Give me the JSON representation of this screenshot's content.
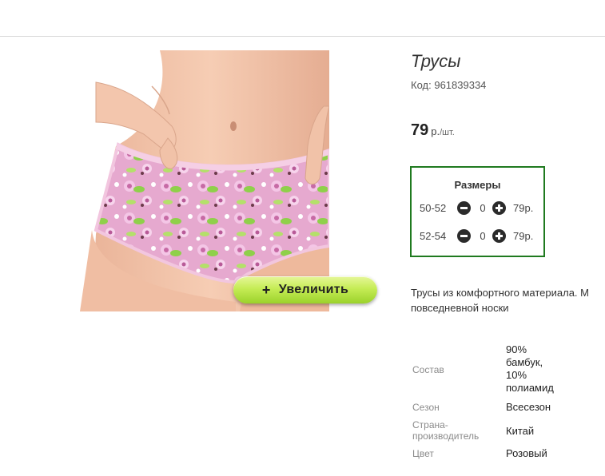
{
  "product": {
    "title": "Трусы",
    "code_label": "Код:",
    "code": "961839334",
    "price": "79",
    "price_unit_main": "р.",
    "price_unit_sub": "/шт.",
    "zoom_button_label": "Увеличить",
    "zoom_button_icon": "+"
  },
  "sizes": {
    "title": "Размеры",
    "rows": [
      {
        "size": "50-52",
        "qty": "0",
        "price": "79р."
      },
      {
        "size": "52-54",
        "qty": "0",
        "price": "79р."
      }
    ]
  },
  "description": {
    "line1": "Трусы из комфортного материала. М",
    "line2": "повседневной носки"
  },
  "specs": [
    {
      "label_lines": [
        "Состав"
      ],
      "value_lines": [
        "90%",
        "бамбук,",
        "10%",
        "полиамид"
      ]
    },
    {
      "label_lines": [
        "Сезон"
      ],
      "value_lines": [
        "Всесезон"
      ]
    },
    {
      "label_lines": [
        "Страна-",
        "производитель"
      ],
      "value_lines": [
        "Китай"
      ]
    },
    {
      "label_lines": [
        "Цвет"
      ],
      "value_lines": [
        "Розовый"
      ]
    }
  ],
  "colors": {
    "sizes_border": "#1f7a1f",
    "zoom_button": "#b5e23d",
    "fabric": "#e8a9d0",
    "skin": "#f3c3a8"
  }
}
